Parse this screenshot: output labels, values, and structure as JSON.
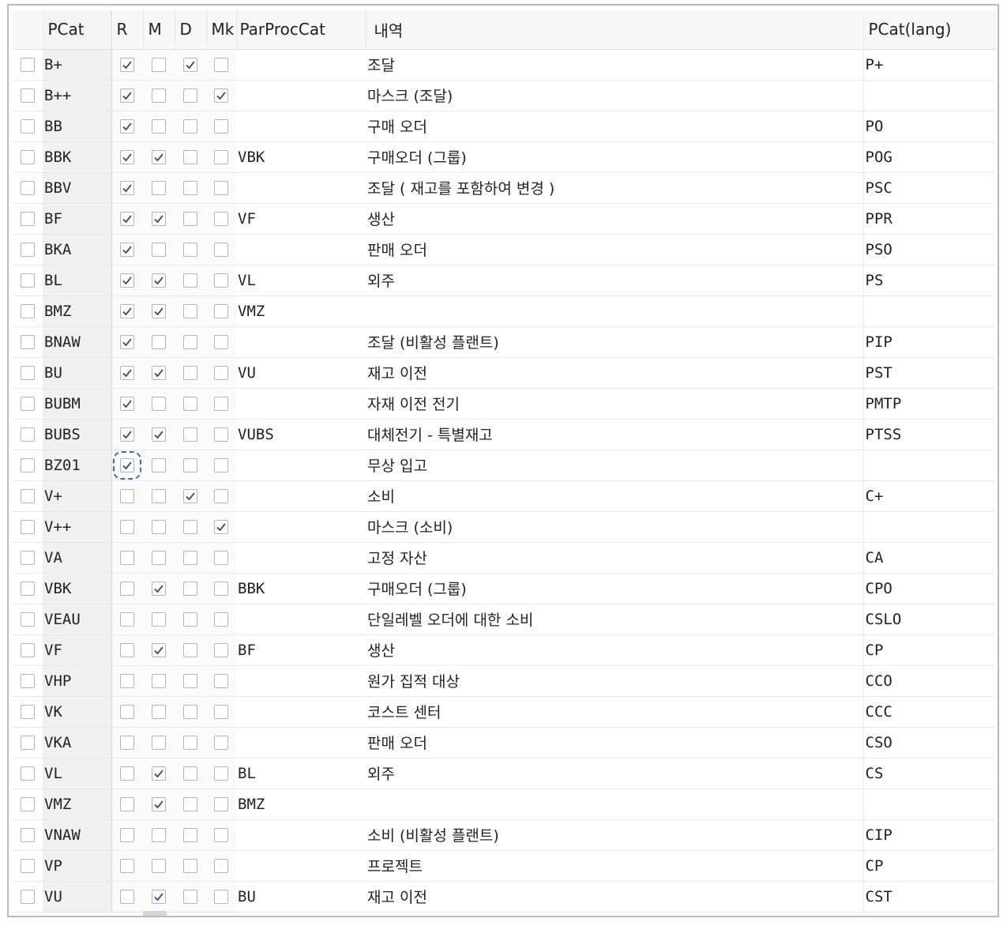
{
  "columns": {
    "select": "",
    "pcat": "PCat",
    "r": "R",
    "m": "M",
    "d": "D",
    "mk": "Mk",
    "parproccat": "ParProcCat",
    "desc": "내역",
    "pcat_lang": "PCat(lang)"
  },
  "colors": {
    "check": "#2b4f8a",
    "focus": "#3a6fb0"
  },
  "icons": {
    "checked": "checkmark-icon"
  },
  "focused_row": 13,
  "rows": [
    {
      "pcat": "B+",
      "r": true,
      "m": false,
      "d": true,
      "mk": false,
      "par": "",
      "desc": "조달",
      "lang": "P+"
    },
    {
      "pcat": "B++",
      "r": true,
      "m": false,
      "d": false,
      "mk": true,
      "par": "",
      "desc": "마스크 (조달)",
      "lang": ""
    },
    {
      "pcat": "BB",
      "r": true,
      "m": false,
      "d": false,
      "mk": false,
      "par": "",
      "desc": "구매 오더",
      "lang": "PO"
    },
    {
      "pcat": "BBK",
      "r": true,
      "m": true,
      "d": false,
      "mk": false,
      "par": "VBK",
      "desc": "구매오더 (그룹)",
      "lang": "POG"
    },
    {
      "pcat": "BBV",
      "r": true,
      "m": false,
      "d": false,
      "mk": false,
      "par": "",
      "desc": "조달 ( 재고를 포함하여 변경 )",
      "lang": "PSC"
    },
    {
      "pcat": "BF",
      "r": true,
      "m": true,
      "d": false,
      "mk": false,
      "par": "VF",
      "desc": "생산",
      "lang": "PPR"
    },
    {
      "pcat": "BKA",
      "r": true,
      "m": false,
      "d": false,
      "mk": false,
      "par": "",
      "desc": "판매 오더",
      "lang": "PSO"
    },
    {
      "pcat": "BL",
      "r": true,
      "m": true,
      "d": false,
      "mk": false,
      "par": "VL",
      "desc": "외주",
      "lang": "PS"
    },
    {
      "pcat": "BMZ",
      "r": true,
      "m": true,
      "d": false,
      "mk": false,
      "par": "VMZ",
      "desc": "",
      "lang": ""
    },
    {
      "pcat": "BNAW",
      "r": true,
      "m": false,
      "d": false,
      "mk": false,
      "par": "",
      "desc": "조달 (비활성 플랜트)",
      "lang": "PIP"
    },
    {
      "pcat": "BU",
      "r": true,
      "m": true,
      "d": false,
      "mk": false,
      "par": "VU",
      "desc": "재고 이전",
      "lang": "PST"
    },
    {
      "pcat": "BUBM",
      "r": true,
      "m": false,
      "d": false,
      "mk": false,
      "par": "",
      "desc": "자재 이전 전기",
      "lang": "PMTP"
    },
    {
      "pcat": "BUBS",
      "r": true,
      "m": true,
      "d": false,
      "mk": false,
      "par": "VUBS",
      "desc": "대체전기 - 특별재고",
      "lang": "PTSS"
    },
    {
      "pcat": "BZ01",
      "r": true,
      "m": false,
      "d": false,
      "mk": false,
      "par": "",
      "desc": "무상 입고",
      "lang": ""
    },
    {
      "pcat": "V+",
      "r": false,
      "m": false,
      "d": true,
      "mk": false,
      "par": "",
      "desc": "소비",
      "lang": "C+"
    },
    {
      "pcat": "V++",
      "r": false,
      "m": false,
      "d": false,
      "mk": true,
      "par": "",
      "desc": "마스크 (소비)",
      "lang": ""
    },
    {
      "pcat": "VA",
      "r": false,
      "m": false,
      "d": false,
      "mk": false,
      "par": "",
      "desc": "고정 자산",
      "lang": "CA"
    },
    {
      "pcat": "VBK",
      "r": false,
      "m": true,
      "d": false,
      "mk": false,
      "par": "BBK",
      "desc": "구매오더 (그룹)",
      "lang": "CPO"
    },
    {
      "pcat": "VEAU",
      "r": false,
      "m": false,
      "d": false,
      "mk": false,
      "par": "",
      "desc": "단일레벨 오더에 대한 소비",
      "lang": "CSLO"
    },
    {
      "pcat": "VF",
      "r": false,
      "m": true,
      "d": false,
      "mk": false,
      "par": "BF",
      "desc": "생산",
      "lang": "CP"
    },
    {
      "pcat": "VHP",
      "r": false,
      "m": false,
      "d": false,
      "mk": false,
      "par": "",
      "desc": "원가 집적 대상",
      "lang": "CCO"
    },
    {
      "pcat": "VK",
      "r": false,
      "m": false,
      "d": false,
      "mk": false,
      "par": "",
      "desc": "코스트 센터",
      "lang": "CCC"
    },
    {
      "pcat": "VKA",
      "r": false,
      "m": false,
      "d": false,
      "mk": false,
      "par": "",
      "desc": "판매 오더",
      "lang": "CSO"
    },
    {
      "pcat": "VL",
      "r": false,
      "m": true,
      "d": false,
      "mk": false,
      "par": "BL",
      "desc": "외주",
      "lang": "CS"
    },
    {
      "pcat": "VMZ",
      "r": false,
      "m": true,
      "d": false,
      "mk": false,
      "par": "BMZ",
      "desc": "",
      "lang": ""
    },
    {
      "pcat": "VNAW",
      "r": false,
      "m": false,
      "d": false,
      "mk": false,
      "par": "",
      "desc": "소비 (비활성 플랜트)",
      "lang": "CIP"
    },
    {
      "pcat": "VP",
      "r": false,
      "m": false,
      "d": false,
      "mk": false,
      "par": "",
      "desc": "프로젝트",
      "lang": "CP"
    },
    {
      "pcat": "VU",
      "r": false,
      "m": true,
      "d": false,
      "mk": false,
      "par": "BU",
      "desc": "재고 이전",
      "lang": "CST"
    }
  ]
}
